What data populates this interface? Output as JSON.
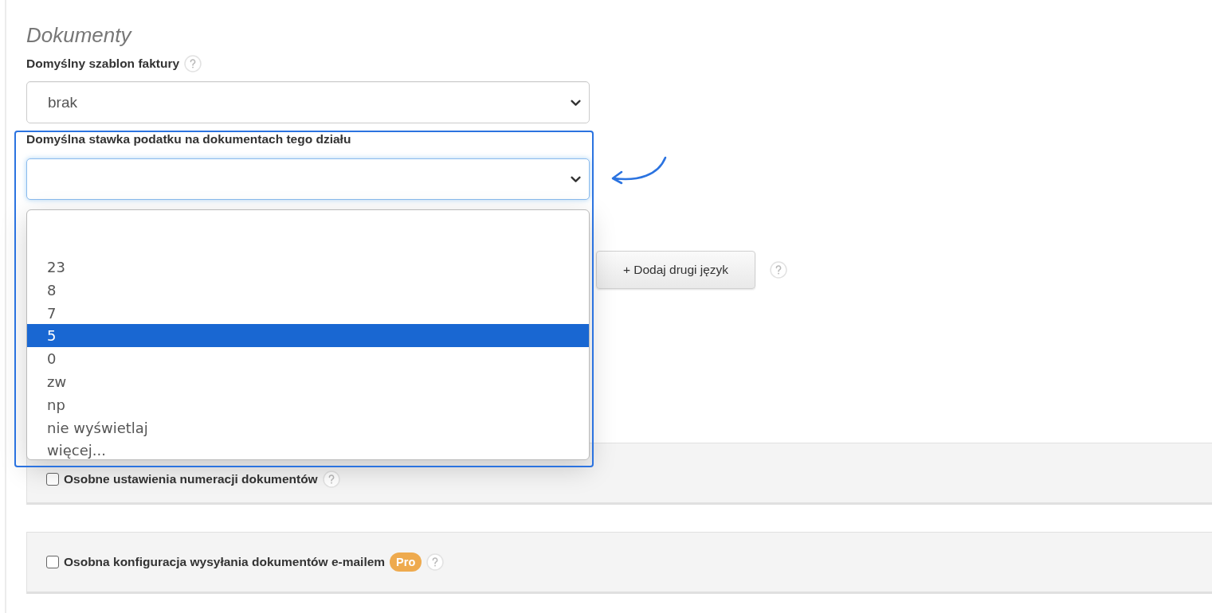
{
  "section_title": "Dokumenty",
  "invoice_template": {
    "label": "Domyślny szablon faktury",
    "help": true,
    "value": "brak"
  },
  "tax_rate": {
    "label": "Domyślna stawka podatku na dokumentach tego działu",
    "highlighted": true,
    "expanded": true,
    "options": [
      {
        "label": "23",
        "selected": false
      },
      {
        "label": "8",
        "selected": false
      },
      {
        "label": "7",
        "selected": false
      },
      {
        "label": "5",
        "selected": true
      },
      {
        "label": "0",
        "selected": false
      },
      {
        "label": "zw",
        "selected": false
      },
      {
        "label": "np",
        "selected": false
      },
      {
        "label": "nie wyświetlaj",
        "selected": false
      },
      {
        "label": "więcej...",
        "selected": false
      }
    ]
  },
  "language_button": {
    "label": "+ Dodaj drugi język",
    "help": true
  },
  "panels": [
    {
      "label": "Osobne ustawienia numeracji dokumentów",
      "checked": false,
      "help": true
    },
    {
      "label": "Osobna konfiguracja wysyłania dokumentów e-mailem",
      "checked": false,
      "badge": "Pro",
      "help": true
    }
  ]
}
